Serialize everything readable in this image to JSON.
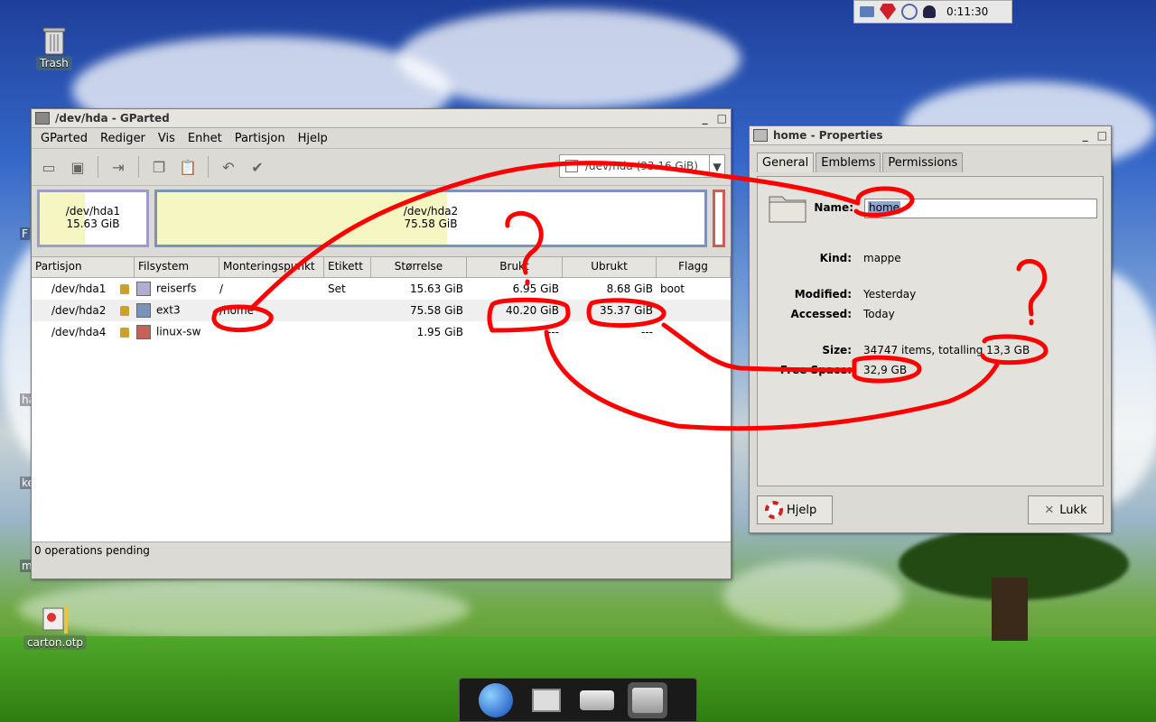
{
  "desktop": {
    "trash_label": "Trash",
    "file_label": "carton.otp",
    "edge_labels": [
      "F",
      "ha",
      "ke",
      "m"
    ]
  },
  "tray": {
    "clock": "0:11:30"
  },
  "gparted": {
    "title": "/dev/hda - GParted",
    "menu": [
      "GParted",
      "Rediger",
      "Vis",
      "Enhet",
      "Partisjon",
      "Hjelp"
    ],
    "device_select": "/dev/hda  (93.16 GiB)",
    "map": [
      {
        "name": "/dev/hda1",
        "size": "15.63 GiB",
        "used_fraction": 0.42
      },
      {
        "name": "/dev/hda2",
        "size": "75.58 GiB",
        "used_fraction": 0.53
      }
    ],
    "columns": [
      "Partisjon",
      "Filsystem",
      "Monteringspunkt",
      "Etikett",
      "Størrelse",
      "Brukt",
      "Ubrukt",
      "Flagg"
    ],
    "rows": [
      {
        "partition": "/dev/hda1",
        "fs": "reiserfs",
        "fs_color": "#b1aed0",
        "mount": "/",
        "label": "Set",
        "size": "15.63 GiB",
        "used": "6.95 GiB",
        "unused": "8.68 GiB",
        "flags": "boot"
      },
      {
        "partition": "/dev/hda2",
        "fs": "ext3",
        "fs_color": "#7b93b9",
        "mount": "/home",
        "label": "",
        "size": "75.58 GiB",
        "used": "40.20 GiB",
        "unused": "35.37 GiB",
        "flags": ""
      },
      {
        "partition": "/dev/hda4",
        "fs": "linux-swap",
        "fs_color": "#c8605a",
        "mount": "",
        "label": "",
        "size": "1.95 GiB",
        "used": "---",
        "unused": "---",
        "flags": ""
      }
    ],
    "status": "0 operations pending"
  },
  "props": {
    "title": "home - Properties",
    "tabs": [
      "General",
      "Emblems",
      "Permissions"
    ],
    "name_label": "Name:",
    "name_value": "home",
    "kind_label": "Kind:",
    "kind_value": "mappe",
    "modified_label": "Modified:",
    "modified_value": "Yesterday",
    "accessed_label": "Accessed:",
    "accessed_value": "Today",
    "size_label": "Size:",
    "size_value": "34747 items, totalling 13,3 GB",
    "free_label": "Free Space:",
    "free_value": "32,9 GB",
    "help_button": "Hjelp",
    "close_button": "Lukk"
  },
  "annotation": {
    "question_mark": "?"
  }
}
